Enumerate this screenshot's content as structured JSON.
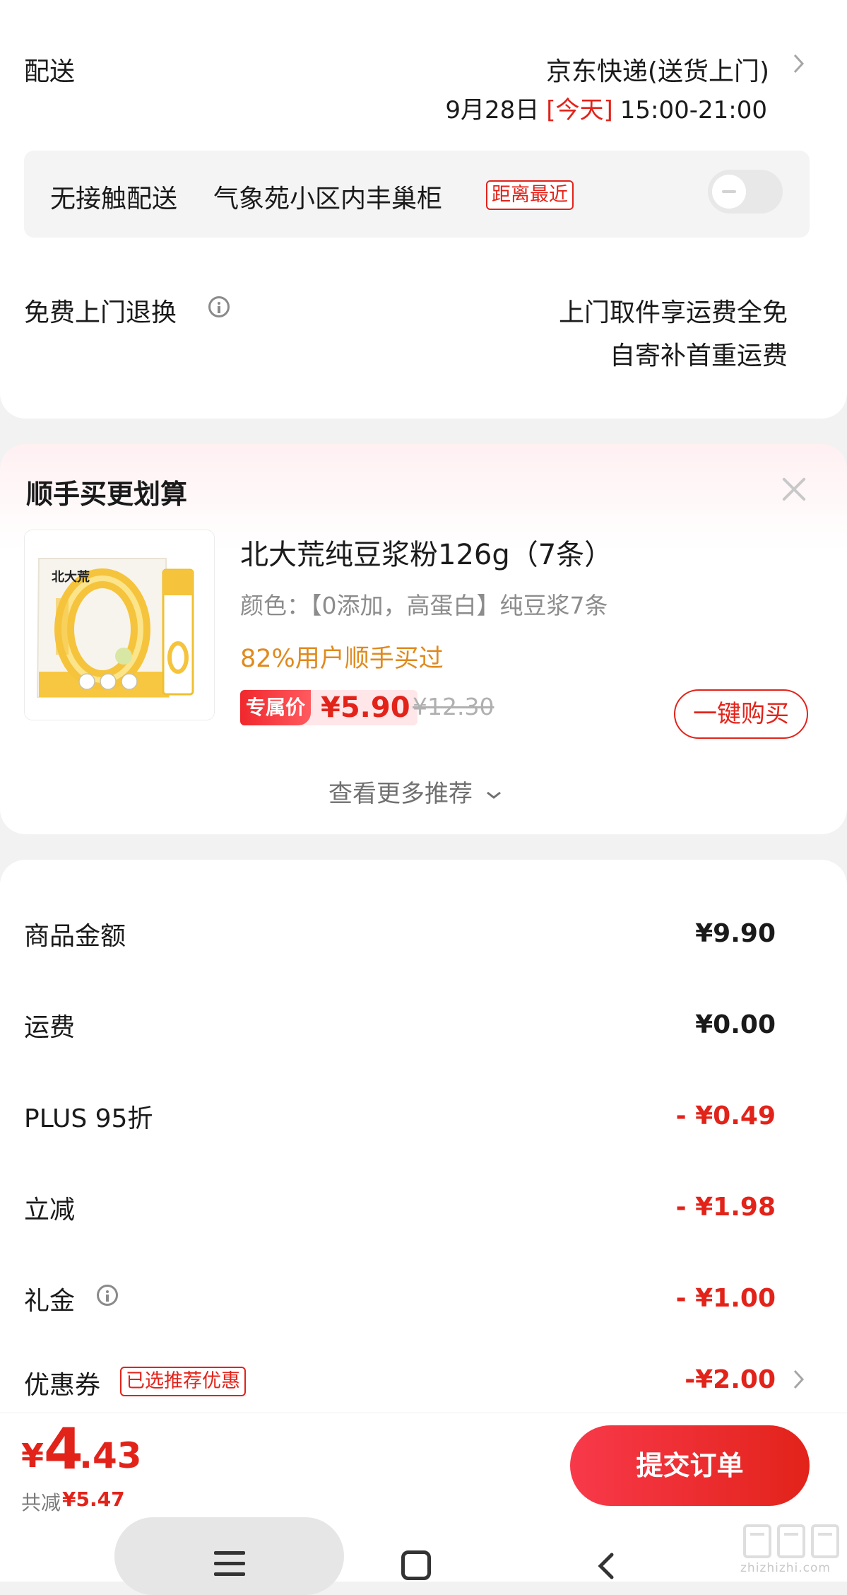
{
  "delivery": {
    "label": "配送",
    "carrier": "京东快递(送货上门)",
    "date": "9月28日",
    "today_tag": "[今天]",
    "time_window": "15:00-21:00",
    "contactless_label": "无接触配送",
    "locker_name": "气象苑小区内丰巢柜",
    "nearest_tag": "距离最近",
    "contactless_enabled": false
  },
  "returns": {
    "label": "免费上门退换",
    "line1": "上门取件享运费全免",
    "line2": "自寄补首重运费"
  },
  "upsell": {
    "title": "顺手买更划算",
    "product": {
      "name": "北大荒纯豆浆粉126g（7条）",
      "spec": "颜色：【0添加，高蛋白】纯豆浆7条",
      "social_proof": "82%用户顺手买过",
      "price_tag": "专属价",
      "price": "¥5.90",
      "original_price": "¥12.30",
      "buy_button": "一键购买",
      "brand_logo_text": "北大荒"
    },
    "more_link": "查看更多推荐"
  },
  "summary": {
    "rows": [
      {
        "label": "商品金额",
        "value": "¥9.90"
      },
      {
        "label": "运费",
        "value": "¥0.00"
      },
      {
        "label": "PLUS 95折",
        "value": "- ¥0.49"
      },
      {
        "label": "立减",
        "value": "- ¥1.98"
      },
      {
        "label": "礼金",
        "value": "- ¥1.00"
      },
      {
        "label": "优惠券",
        "value": "-¥2.00",
        "tag": "已选推荐优惠"
      }
    ]
  },
  "footer": {
    "total_currency": "¥",
    "total_int": "4",
    "total_dec": ".43",
    "saved_label": "共减",
    "saved_value": "¥5.47",
    "submit_label": "提交订单"
  },
  "colors": {
    "accent_red": "#e2231a",
    "orange": "#e08a1e",
    "background": "#f2f2f2"
  },
  "watermark": {
    "text": "zhizhizhi.com"
  }
}
